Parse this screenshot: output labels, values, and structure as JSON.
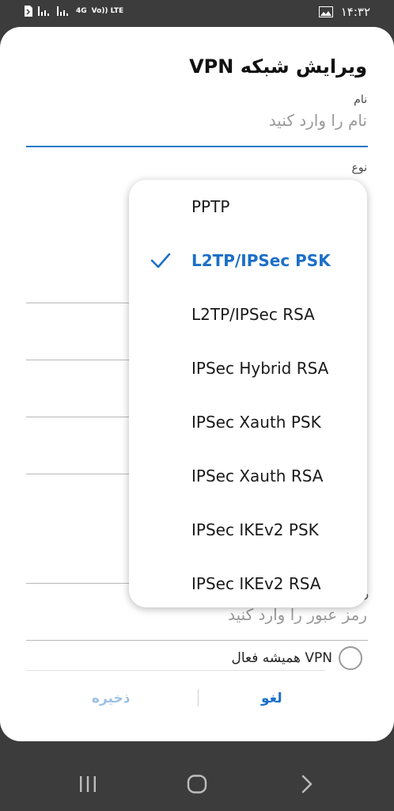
{
  "status_bar": {
    "network_type": "4G",
    "volte": "Vo)) LTE",
    "time": "۱۴:۳۲"
  },
  "dialog": {
    "title": "ویرایش شبکه VPN",
    "name_label": "نام",
    "name_placeholder": "نام را وارد کنید",
    "type_label": "نوع",
    "password_label": "ر",
    "password_placeholder": "رمز عبور را وارد کنید",
    "always_on_label": "VPN همیشه فعال",
    "cancel_label": "لغو",
    "save_label": "ذخیره"
  },
  "type_options": [
    {
      "label": "PPTP",
      "selected": false
    },
    {
      "label": "L2TP/IPSec PSK",
      "selected": true
    },
    {
      "label": "L2TP/IPSec RSA",
      "selected": false
    },
    {
      "label": "IPSec Hybrid RSA",
      "selected": false
    },
    {
      "label": "IPSec Xauth PSK",
      "selected": false
    },
    {
      "label": "IPSec Xauth RSA",
      "selected": false
    },
    {
      "label": "IPSec IKEv2 PSK",
      "selected": false
    },
    {
      "label": "IPSec IKEv2 RSA",
      "selected": false
    }
  ],
  "colors": {
    "accent": "#1b6fc8",
    "accent_disabled": "#9fc0e6",
    "underline_active": "#2a79c9",
    "background_dim": "#3c3c3c"
  },
  "icons": {
    "status_left": [
      "sim-icon",
      "signal-icon",
      "signal-icon"
    ],
    "status_right": [
      "gallery-icon"
    ],
    "nav": [
      "recents-icon",
      "home-icon",
      "back-icon"
    ]
  }
}
